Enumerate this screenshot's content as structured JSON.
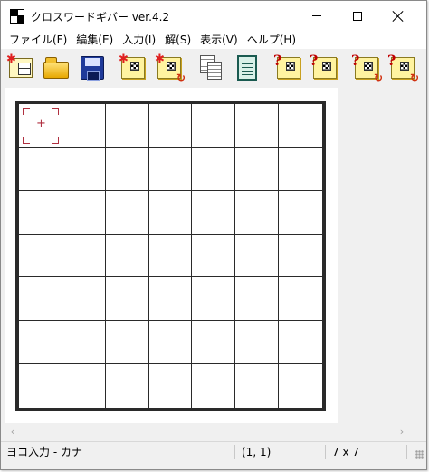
{
  "window": {
    "title": "クロスワードギバー ver.4.2",
    "controls": {
      "minimize": "minimize",
      "maximize": "maximize",
      "close": "close"
    }
  },
  "menu": [
    {
      "label": "ファイル(F)"
    },
    {
      "label": "編集(E)"
    },
    {
      "label": "入力(I)"
    },
    {
      "label": "解(S)"
    },
    {
      "label": "表示(V)"
    },
    {
      "label": "ヘルプ(H)"
    }
  ],
  "toolbar": {
    "buttons": [
      {
        "name": "new-puzzle",
        "icon": "new-grid-icon"
      },
      {
        "name": "open-file",
        "icon": "folder-open-icon"
      },
      {
        "name": "save-file",
        "icon": "floppy-disk-icon"
      },
      {
        "name": "new-blank",
        "icon": "puzzle-new-icon"
      },
      {
        "name": "generate",
        "icon": "puzzle-generate-icon"
      },
      {
        "name": "copy",
        "icon": "copy-pages-icon"
      },
      {
        "name": "notes",
        "icon": "notes-icon"
      },
      {
        "name": "check-1",
        "icon": "question-puzzle-icon"
      },
      {
        "name": "check-2",
        "icon": "question-puzzle-icon"
      },
      {
        "name": "solve-1",
        "icon": "question-puzzle-arrow-icon"
      },
      {
        "name": "solve-2",
        "icon": "question-puzzle-arrow-icon"
      }
    ]
  },
  "grid": {
    "rows": 7,
    "cols": 7,
    "cursor": {
      "row": 1,
      "col": 1
    }
  },
  "status": {
    "mode": "ヨコ入力 - カナ",
    "position": "(1, 1)",
    "size": "7 x 7"
  },
  "colors": {
    "cursor": "#b03040",
    "grid_line": "#2a2a2a",
    "toolbar_bg": "#f0f0f0"
  }
}
